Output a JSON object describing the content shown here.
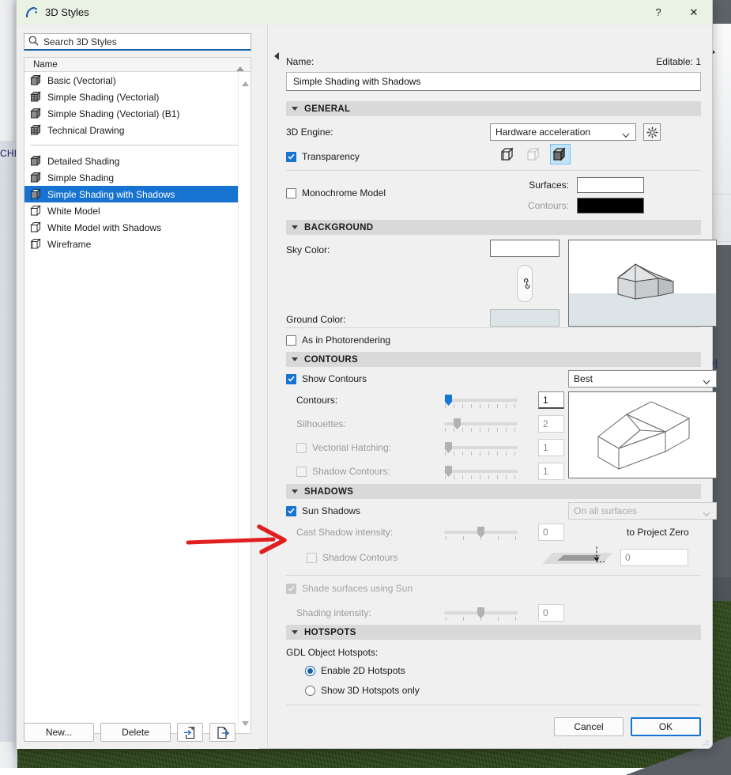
{
  "window": {
    "title": "3D Styles",
    "icon": "archicad-3d-styles-icon",
    "help_label": "?",
    "close_label": "✕"
  },
  "background": {
    "fragment_left": "CHE",
    "fragment_right": "e]"
  },
  "left_panel": {
    "search": {
      "placeholder": "Search 3D Styles",
      "value": "",
      "icon": "search-icon"
    },
    "list_header": {
      "column": "Name",
      "sort_icon": "sort-ascending-icon"
    },
    "group_1": [
      {
        "label": "Basic (Vectorial)",
        "icon": "style-solid-icon"
      },
      {
        "label": "Simple Shading (Vectorial)",
        "icon": "style-hatched-icon"
      },
      {
        "label": "Simple Shading (Vectorial) (B1)",
        "icon": "style-solid-icon"
      },
      {
        "label": "Technical Drawing",
        "icon": "style-hatched-icon"
      }
    ],
    "group_2": [
      {
        "label": "Detailed Shading",
        "icon": "style-solid-icon",
        "selected": false
      },
      {
        "label": "Simple Shading",
        "icon": "style-solid-icon",
        "selected": false
      },
      {
        "label": "Simple Shading with Shadows",
        "icon": "style-solid-icon",
        "selected": true
      },
      {
        "label": "White Model",
        "icon": "style-white-icon",
        "selected": false
      },
      {
        "label": "White Model with Shadows",
        "icon": "style-white-icon",
        "selected": false
      },
      {
        "label": "Wireframe",
        "icon": "style-wireframe-icon",
        "selected": false
      }
    ],
    "buttons": {
      "new": "New...",
      "delete": "Delete",
      "import_icon": "import-style-icon",
      "export_icon": "export-style-icon"
    },
    "scroll": {
      "up_icon": "scroll-up-arrow",
      "down_icon": "scroll-down-arrow"
    },
    "collapse_icon": "collapse-panel-arrow"
  },
  "right_panel": {
    "name_label": "Name:",
    "editable_label": "Editable: 1",
    "name_value": "Simple Shading with Shadows",
    "general": {
      "header": "GENERAL",
      "engine_label": "3D Engine:",
      "engine_value": "Hardware acceleration",
      "engine_options": [
        "Hardware acceleration"
      ],
      "engine_settings_icon": "gear-icon",
      "transparency_label": "Transparency",
      "transparency_checked": true,
      "mode_icons": [
        {
          "name": "wireframe-cube-icon",
          "selected": false,
          "disabled": false
        },
        {
          "name": "hidden-line-cube-icon",
          "selected": false,
          "disabled": true
        },
        {
          "name": "shaded-cube-icon",
          "selected": true,
          "disabled": false
        }
      ],
      "monochrome_label": "Monochrome Model",
      "monochrome_checked": false,
      "surfaces_label": "Surfaces:",
      "surfaces_color": "#ffffff",
      "contours_label": "Contours:",
      "contours_color": "#000000"
    },
    "background": {
      "header": "BACKGROUND",
      "sky_label": "Sky Color:",
      "sky_color": "#ffffff",
      "ground_label": "Ground Color:",
      "ground_color": "#dde4e8",
      "link_icon": "chain-link-icon",
      "preview_name": "background-preview",
      "photorendering_label": "As in Photorendering",
      "photorendering_checked": false
    },
    "contours": {
      "header": "CONTOURS",
      "show_label": "Show Contours",
      "show_checked": true,
      "quality_value": "Best",
      "quality_options": [
        "Best"
      ],
      "rows": [
        {
          "label": "Contours:",
          "value": "1",
          "slider_pct": 3,
          "enabled": true,
          "has_checkbox": false,
          "checked": false,
          "accent": true
        },
        {
          "label": "Silhouettes:",
          "value": "2",
          "slider_pct": 13,
          "enabled": false,
          "has_checkbox": false,
          "checked": false,
          "accent": false
        },
        {
          "label": "Vectorial Hatching:",
          "value": "1",
          "slider_pct": 3,
          "enabled": false,
          "has_checkbox": true,
          "checked": false,
          "accent": false
        },
        {
          "label": "Shadow Contours:",
          "value": "1",
          "slider_pct": 3,
          "enabled": false,
          "has_checkbox": true,
          "checked": false,
          "accent": false
        }
      ],
      "preview_name": "contours-preview"
    },
    "shadows": {
      "header": "SHADOWS",
      "sun_shadows_label": "Sun Shadows",
      "sun_shadows_checked": true,
      "surfaces_value": "On all surfaces",
      "surfaces_options": [
        "On all surfaces"
      ],
      "cast_intensity_label": "Cast Shadow intensity:",
      "cast_intensity_value": "0",
      "cast_intensity_pct": 50,
      "to_project_zero_label": "to Project Zero",
      "shadow_contours_label": "Shadow Contours",
      "shadow_contours_checked": false,
      "offset_value": "0",
      "offset_icon": "shadow-offset-diagram",
      "shade_surfaces_label": "Shade surfaces using Sun",
      "shade_surfaces_checked": true,
      "shading_intensity_label": "Shading intensity:",
      "shading_intensity_value": "0",
      "shading_intensity_pct": 50
    },
    "hotspots": {
      "header": "HOTSPOTS",
      "gdl_label": "GDL Object Hotspots:",
      "options": [
        {
          "label": "Enable 2D Hotspots",
          "selected": true
        },
        {
          "label": "Show 3D Hotspots only",
          "selected": false
        }
      ]
    },
    "footer": {
      "cancel": "Cancel",
      "ok": "OK"
    }
  },
  "annotation": {
    "type": "red-arrow",
    "points_at": "Cast Shadow intensity:",
    "color": "#e02020"
  },
  "colors": {
    "accent": "#1673d1",
    "selection": "#1673d1",
    "title_bar": "#eaf2e4",
    "dialog_bg": "#f0f0f0",
    "section_hdr": "#d9d9d9"
  }
}
